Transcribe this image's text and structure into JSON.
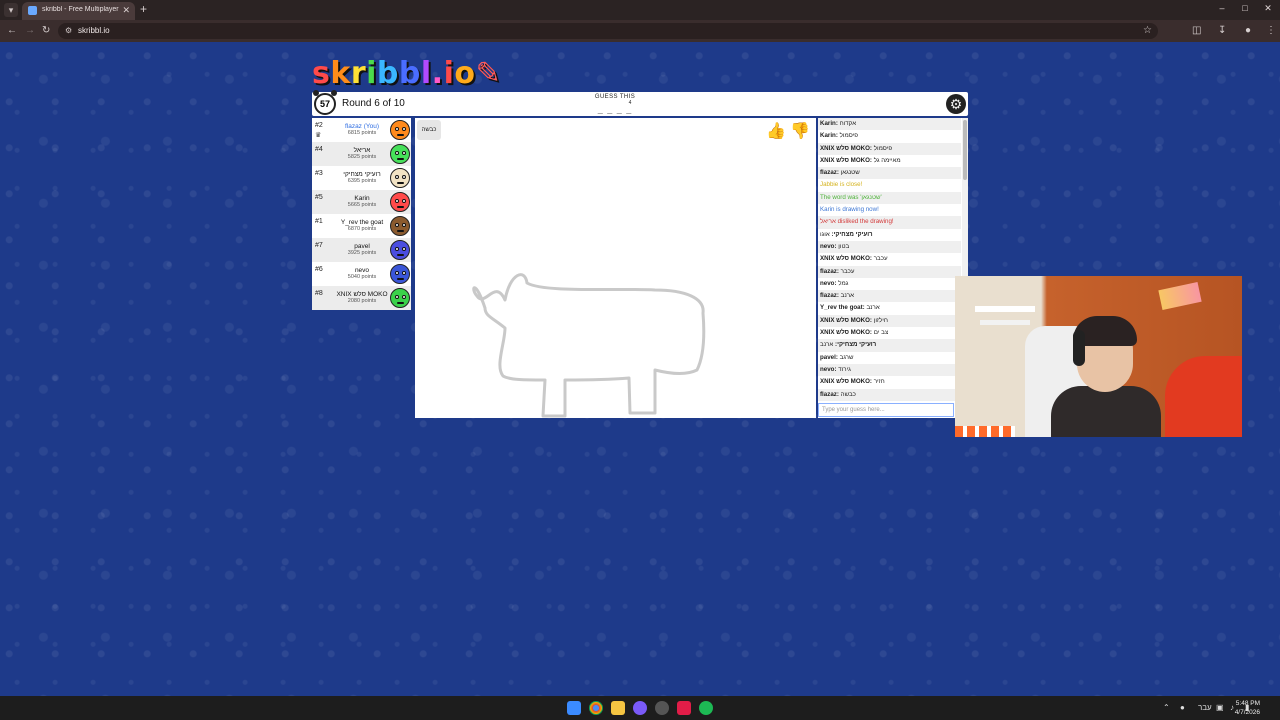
{
  "browser": {
    "tab_title": "skribbl - Free Multiplayer Drawi",
    "url": "skribbl.io"
  },
  "logo": {
    "text": "skribbl.io",
    "letters": [
      {
        "ch": "s",
        "color": "#ff4a4a"
      },
      {
        "ch": "k",
        "color": "#ff8c1a"
      },
      {
        "ch": "r",
        "color": "#ffe135"
      },
      {
        "ch": "i",
        "color": "#4cdc4c"
      },
      {
        "ch": "b",
        "color": "#3ab7ff"
      },
      {
        "ch": "b",
        "color": "#4a6dff"
      },
      {
        "ch": "l",
        "color": "#b14aff"
      },
      {
        "ch": ".",
        "color": "#ff59c8"
      },
      {
        "ch": "i",
        "color": "#ff4a4a"
      },
      {
        "ch": "o",
        "color": "#ffaa1a"
      }
    ]
  },
  "game": {
    "timer": "57",
    "round_text": "Round 6 of 10",
    "guess_label": "GUESS THIS",
    "guess_count": "4",
    "guess_blanks": "_ _ _ _"
  },
  "players": [
    {
      "rank": "#2",
      "name": "flazaz (You)",
      "points": "6815 points",
      "avatar_color": "#ff8a1c",
      "is_you": true
    },
    {
      "rank": "#4",
      "name": "אריאל",
      "points": "5825 points",
      "avatar_color": "#46e05a",
      "is_you": false
    },
    {
      "rank": "#3",
      "name": "רועיקי מצחיקי",
      "points": "6395 points",
      "avatar_color": "#f2e3c4",
      "is_you": false
    },
    {
      "rank": "#5",
      "name": "Karin",
      "points": "5665 points",
      "avatar_color": "#ff4a4a",
      "is_you": false
    },
    {
      "rank": "#1",
      "name": "Y_rev the goat",
      "points": "6870 points",
      "avatar_color": "#8a5a2e",
      "is_you": false
    },
    {
      "rank": "#7",
      "name": "pavel",
      "points": "3925 points",
      "avatar_color": "#4a4de0",
      "is_you": false
    },
    {
      "rank": "#6",
      "name": "nevo",
      "points": "5040 points",
      "avatar_color": "#3a56d8",
      "is_you": false
    },
    {
      "rank": "#8",
      "name": "XNIX סלש MOKO",
      "points": "2080 points",
      "avatar_color": "#3ad14a",
      "is_you": false
    }
  ],
  "canvas": {
    "word_chip": "כבשה"
  },
  "chat": {
    "messages": [
      {
        "author": "Karin:",
        "text": " אקדוח",
        "kind": "user"
      },
      {
        "author": "Karin:",
        "text": " פיסמול",
        "kind": "user"
      },
      {
        "author": "XNIX סלש MOKO:",
        "text": " פיסמול",
        "kind": "user"
      },
      {
        "author": "XNIX סלש MOKO:",
        "text": " מאיימה גל",
        "kind": "user"
      },
      {
        "author": "flazaz:",
        "text": " שטנגאן",
        "kind": "user"
      },
      {
        "author": "",
        "text": "Jabbie is close!",
        "kind": "sys-yellow"
      },
      {
        "author": "",
        "text": "The word was 'שטנגאן'",
        "kind": "sys-green"
      },
      {
        "author": "",
        "text": "Karin is drawing now!",
        "kind": "sys-blue"
      },
      {
        "author": "",
        "text": "אריאל disliked the drawing!",
        "kind": "sys-red"
      },
      {
        "author": "רועיקי מצחיקי:",
        "text": " אוגו",
        "kind": "user"
      },
      {
        "author": "nevo:",
        "text": " בטון",
        "kind": "user"
      },
      {
        "author": "XNIX סלש MOKO:",
        "text": " עכבר",
        "kind": "user"
      },
      {
        "author": "flazaz:",
        "text": " עכבר",
        "kind": "user"
      },
      {
        "author": "nevo:",
        "text": " גמל",
        "kind": "user"
      },
      {
        "author": "flazaz:",
        "text": " ארנב",
        "kind": "user"
      },
      {
        "author": "Y_rev the goat:",
        "text": " ארנב",
        "kind": "user"
      },
      {
        "author": "XNIX סלש MOKO:",
        "text": " חילזון",
        "kind": "user"
      },
      {
        "author": "XNIX סלש MOKO:",
        "text": " צב ים",
        "kind": "user"
      },
      {
        "author": "רועיקי מצחיקי:",
        "text": " ארנב",
        "kind": "user"
      },
      {
        "author": "pavel:",
        "text": " שרגב",
        "kind": "user"
      },
      {
        "author": "nevo:",
        "text": " גירוד",
        "kind": "user"
      },
      {
        "author": "XNIX סלש MOKO:",
        "text": " חזיר",
        "kind": "user"
      },
      {
        "author": "flazaz:",
        "text": " כבשה",
        "kind": "user"
      }
    ],
    "input_placeholder": "Type your guess here..."
  },
  "taskbar": {
    "lang": "עבר",
    "time": "5:48 PM",
    "date": "4/7/2026"
  },
  "icons": {
    "settings": "gear-icon",
    "like": "thumbs-up-icon",
    "dislike": "thumbs-down-icon",
    "timer": "alarm-clock-icon"
  }
}
